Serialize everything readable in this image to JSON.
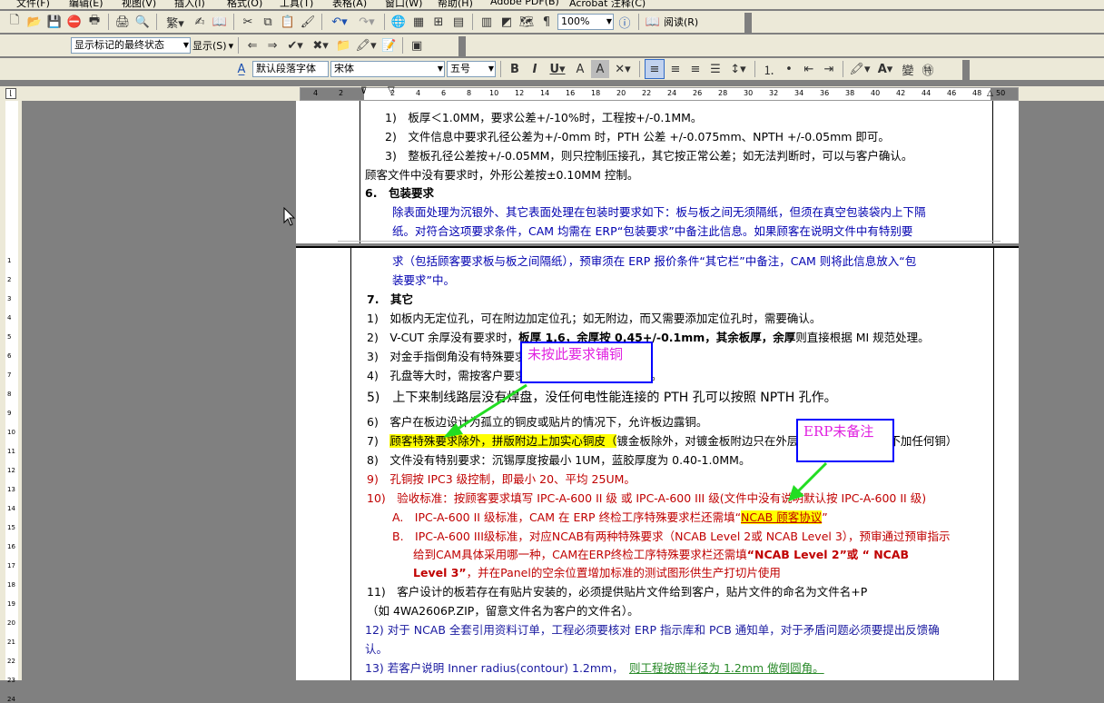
{
  "menu": [
    "文件(F)",
    "编辑(E)",
    "视图(V)",
    "插入(I)",
    "格式(O)",
    "工具(T)",
    "表格(A)",
    "窗口(W)",
    "帮助(H)",
    "Adobe PDF(B)",
    "Acrobat 注释(C)"
  ],
  "toolbar1": {
    "zoom": "100%",
    "read_label": "阅读(R)"
  },
  "toolbar2": {
    "markup_state": "显示标记的最终状态",
    "show_label": "显示(S)"
  },
  "toolbar3": {
    "style": "默认段落字体",
    "font": "宋体",
    "size": "五号"
  },
  "ruler": {
    "ticks": [
      "4",
      "2",
      "2",
      "4",
      "6",
      "8",
      "10",
      "12",
      "14",
      "16",
      "18",
      "20",
      "22",
      "24",
      "26",
      "28",
      "30",
      "32",
      "34",
      "36",
      "38",
      "40",
      "42",
      "44",
      "46",
      "48",
      "50"
    ]
  },
  "vruler": {
    "ticks": [
      "1",
      "2",
      "3",
      "4",
      "5",
      "6",
      "7",
      "8",
      "9",
      "10",
      "11",
      "12",
      "13",
      "14",
      "15",
      "16",
      "17",
      "18",
      "19",
      "20",
      "21",
      "22",
      "23",
      "24"
    ]
  },
  "doc": {
    "p1_l1": "1)　板厚＜1.0MM，要求公差+/-10%时，工程按+/-0.1MM。",
    "p1_l2": "2)　文件信息中要求孔径公差为+/-0mm 时，PTH 公差 +/-0.075mm、NPTH +/-0.05mm 即可。",
    "p1_l3": "3)　整板孔径公差按+/-0.05MM，则只控制压接孔，其它按正常公差；如无法判断时，可以与客户确认。",
    "p1_l4": "顾客文件中没有要求时，外形公差按±0.10MM 控制。",
    "p1_h6": "6.　包装要求",
    "p1_l5": "除表面处理为沉银外、其它表面处理在包装时要求如下：板与板之间无须隔纸，但须在真空包装袋内上下隔",
    "p1_l6": "纸。对符合这项要求条件，CAM 均需在 ERP“包装要求”中备注此信息。如果顾客在说明文件中有特别要",
    "p2_l1": "求（包括顾客要求板与板之间隔纸），预审须在 ERP 报价条件“其它栏”中备注，CAM 则将此信息放入“包",
    "p2_l2": "装要求”中。",
    "p2_h7": "7.　其它",
    "p2_l3": "1)　如板内无定位孔，可在附边加定位孔；如无附边，而又需要添加定位孔时，需要确认。",
    "p2_l4a": "2)　V-CUT 余厚没有要求时，",
    "p2_l4b": "板厚 1.6，余厚按 0.45+/-0.1mm，其余板厚，余厚",
    "p2_l4c": "则直接根据 MI 规范处理。",
    "p2_l5": "3)　对金手指倒角没有特殊要求时，按常规制作。",
    "p2_l6": "4)　孔盘等大时，需按客户要求确认是否可以更改孔属性。",
    "p2_l7": "5)　上下来制线路层没有焊盘，没任何电性能连接的 PTH 孔可以按照 NPTH 孔作。",
    "p2_l8": "6)　客户在板边设计为孤立的铜皮或贴片的情况下，允许板边露铜。",
    "p2_l9a": "7)　",
    "p2_l9b": "顾客特殊要求除外，拼版附边上加实心铜皮（",
    "p2_l9c": "镀金板除外，对镀金板附边只在外层加实心铜皮，内层不加任何铜）",
    "p2_l10": "8)　文件没有特别要求：沉锡厚度按最小 1UM，蓝胶厚度为 0.40-1.0MM。",
    "p2_l11": "9)　孔铜按 IPC3 级控制，即最小 20、平均 25UM。",
    "p2_l12": "10)　验收标准：按顾客要求填写 IPC-A-600 II 级 或 IPC-A-600 III 级(文件中没有说明默认按 IPC-A-600 II 级)",
    "p2_l13a": "A.　IPC-A-600 II 级标准，CAM 在 ERP 终检工序特殊要求栏还需填“",
    "p2_l13b": "NCAB 顾客协议",
    "p2_l13c": "”",
    "p2_l14": "B.　IPC-A-600 III级标准，对应NCAB有两种特殊要求（NCAB Level 2或 NCAB Level 3），预审通过预审指示",
    "p2_l15a": "给到CAM具体采用哪一种，CAM在ERP终检工序特殊要求栏还需填",
    "p2_l15b": "“NCAB Level 2”或 “ NCAB",
    "p2_l16a": "Level 3”",
    "p2_l16b": "，并在Panel的空余位置增加标准的测试图形供生产打切片使用",
    "p2_l17": "11)　客户设计的板若存在有贴片安装的，必须提供贴片文件给到客户，贴片文件的命名为文件名+P",
    "p2_l18": "（如 4WA2606P.ZIP，留意文件名为客户的文件名）。",
    "p2_l19": "12) 对于 NCAB 全套引用资料订单，工程必须要核对 ERP 指示库和 PCB 通知单，对于矛盾问题必须要提出反馈确",
    "p2_l20": "认。",
    "p2_l21a": "13) 若客户说明 Inner radius(contour) 1.2mm，　",
    "p2_l21b": "则工程按照半径为 1.2mm 做倒圆角。"
  },
  "callouts": {
    "c1": "未按此要求铺铜",
    "c2": "ERP未备注"
  },
  "colors": {
    "accent_blue": "#0000b0",
    "accent_red": "#c00000",
    "highlight": "#ffff00",
    "callout_text": "#e020e0",
    "arrow": "#22dd22"
  }
}
